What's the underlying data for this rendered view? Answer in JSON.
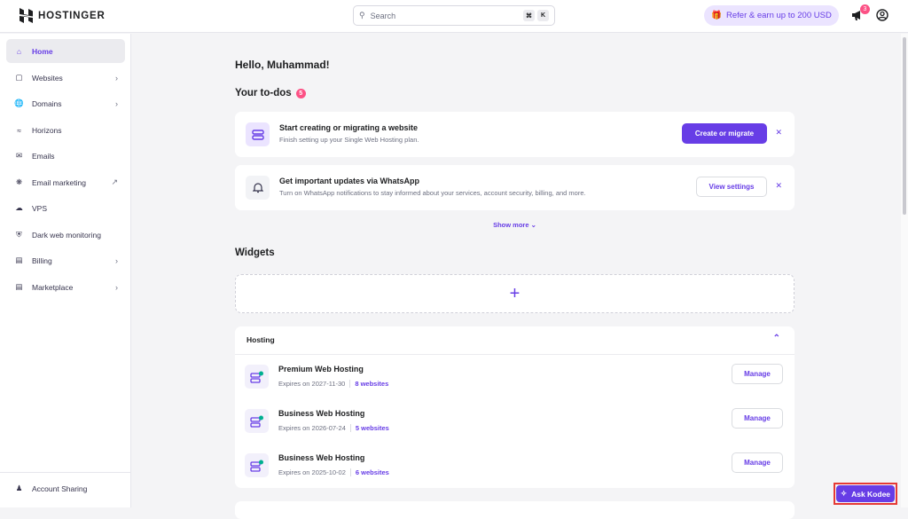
{
  "header": {
    "brand": "HOSTINGER",
    "search_placeholder": "Search",
    "kbd": [
      "⌘",
      "K"
    ],
    "refer_label": "Refer & earn up to 200 USD",
    "notifications_count": "3"
  },
  "sidebar": {
    "items": [
      {
        "label": "Home",
        "active": true
      },
      {
        "label": "Websites",
        "chevron": true
      },
      {
        "label": "Domains",
        "chevron": true
      },
      {
        "label": "Horizons"
      },
      {
        "label": "Emails"
      },
      {
        "label": "Email marketing",
        "external": true
      },
      {
        "label": "VPS"
      },
      {
        "label": "Dark web monitoring"
      },
      {
        "label": "Billing",
        "chevron": true
      },
      {
        "label": "Marketplace",
        "chevron": true
      }
    ],
    "footer": "Account Sharing"
  },
  "main": {
    "greeting": "Hello, Muhammad!",
    "todos_title": "Your to-dos",
    "todos_count": "5",
    "todos": [
      {
        "title": "Start creating or migrating a website",
        "subtitle": "Finish setting up your Single Web Hosting plan.",
        "button": "Create or migrate"
      },
      {
        "title": "Get important updates via WhatsApp",
        "subtitle": "Turn on WhatsApp notifications to stay informed about your services, account security, billing, and more.",
        "button": "View settings"
      }
    ],
    "show_more": "Show more",
    "widgets_title": "Widgets",
    "add_widget": "+",
    "hosting": {
      "title": "Hosting",
      "rows": [
        {
          "name": "Premium Web Hosting",
          "expires": "Expires on 2027-11-30",
          "websites": "8 websites",
          "button": "Manage"
        },
        {
          "name": "Business Web Hosting",
          "expires": "Expires on 2026-07-24",
          "websites": "5 websites",
          "button": "Manage"
        },
        {
          "name": "Business Web Hosting",
          "expires": "Expires on 2025-10-02",
          "websites": "6 websites",
          "button": "Manage"
        }
      ]
    }
  },
  "kodee": "Ask Kodee",
  "colors": {
    "accent": "#673de6",
    "badge": "#fc5185",
    "status": "#00b090"
  }
}
